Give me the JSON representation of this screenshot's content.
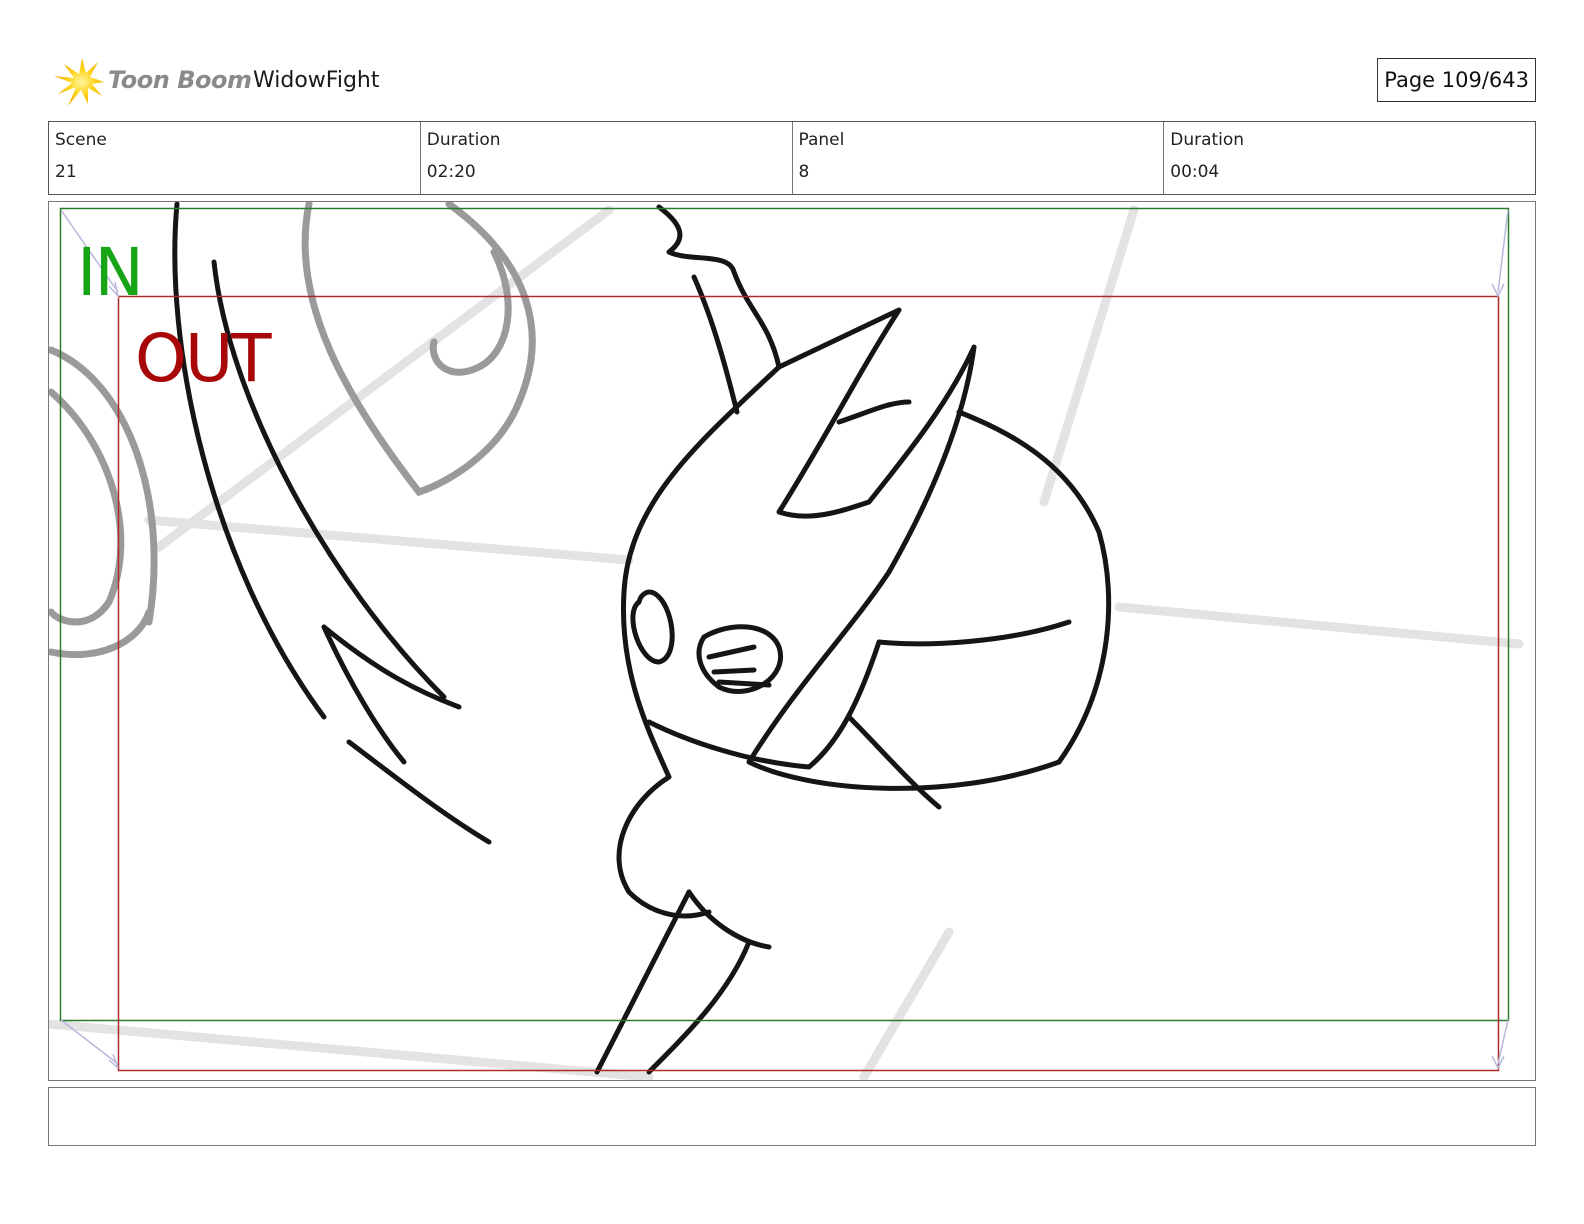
{
  "header": {
    "brand": "Toon Boom",
    "project": "WidowFight",
    "page_counter": "Page 109/643"
  },
  "info": {
    "scene_label": "Scene",
    "scene_value": "21",
    "scene_duration_label": "Duration",
    "scene_duration_value": "02:20",
    "panel_label": "Panel",
    "panel_value": "8",
    "panel_duration_label": "Duration",
    "panel_duration_value": "00:04"
  },
  "panel": {
    "in_label": "IN",
    "out_label": "OUT",
    "in_color": "#17a417",
    "out_color": "#a80808"
  },
  "icons": {
    "logo": "toon-boom-starburst-icon"
  },
  "notes": {
    "text": ""
  }
}
